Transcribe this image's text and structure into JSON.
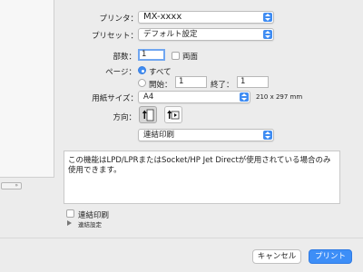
{
  "printer": {
    "label": "プリンタ：",
    "value": "MX-xxxx"
  },
  "preset": {
    "label": "プリセット：",
    "value": "デフォルト設定"
  },
  "copies": {
    "label": "部数：",
    "value": "1",
    "duplex_label": "両面"
  },
  "pages": {
    "label": "ページ：",
    "all_label": "すべて",
    "from_label": "開始：",
    "from_value": "1",
    "to_label": "終了：",
    "to_value": "1",
    "selected": "all"
  },
  "paper_size": {
    "label": "用紙サイズ：",
    "value": "A4",
    "dimensions": "210 x 297 mm"
  },
  "orientation": {
    "label": "方向：",
    "options": [
      "portrait",
      "landscape"
    ],
    "selected": "portrait"
  },
  "section_popup": {
    "value": "連結印刷"
  },
  "message": "この機能はLPD/LPRまたはSocket/HP Jet Directが使用されている場合のみ使用できます。",
  "continuous_print": {
    "label": "連結印刷"
  },
  "continuous_settings": {
    "label": "連結設定"
  },
  "preview_nav": {
    "label": "»"
  },
  "buttons": {
    "cancel": "キャンセル",
    "print": "プリント"
  },
  "colors": {
    "accent": "#3d8ef7",
    "background": "#ececec"
  }
}
